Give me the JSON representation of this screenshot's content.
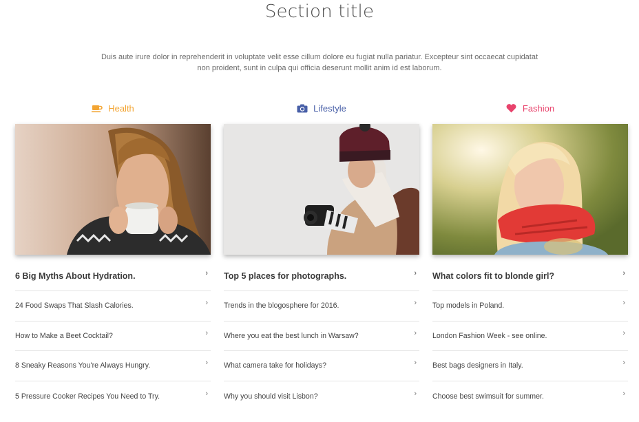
{
  "header": {
    "title": "Section title",
    "intro": "Duis aute irure dolor in reprehenderit in voluptate velit esse cillum dolore eu fugiat nulla pariatur. Excepteur sint occaecat cupidatat non proident, sunt in culpa qui officia deserunt mollit anim id est laborum."
  },
  "columns": [
    {
      "category": "Health",
      "icon": "coffee-icon",
      "color": "#f3a533",
      "items": [
        "6 Big Myths About Hydration.",
        "24 Food Swaps That Slash Calories.",
        "How to Make a Beet Cocktail?",
        "8 Sneaky Reasons You're Always Hungry.",
        "5 Pressure Cooker Recipes You Need to Try."
      ]
    },
    {
      "category": "Lifestyle",
      "icon": "camera-icon",
      "color": "#4960a8",
      "items": [
        "Top 5 places for photographs.",
        "Trends in the blogosphere for 2016.",
        "Where you eat the best lunch in Warsaw?",
        "What camera take for holidays?",
        "Why you should visit Lisbon?"
      ]
    },
    {
      "category": "Fashion",
      "icon": "heart-icon",
      "color": "#e8436c",
      "items": [
        "What colors fit to blonde girl?",
        "Top models in Poland.",
        "London Fashion Week - see online.",
        "Best bags designers in Italy.",
        "Choose best swimsuit for summer."
      ]
    }
  ],
  "chevron": "›"
}
